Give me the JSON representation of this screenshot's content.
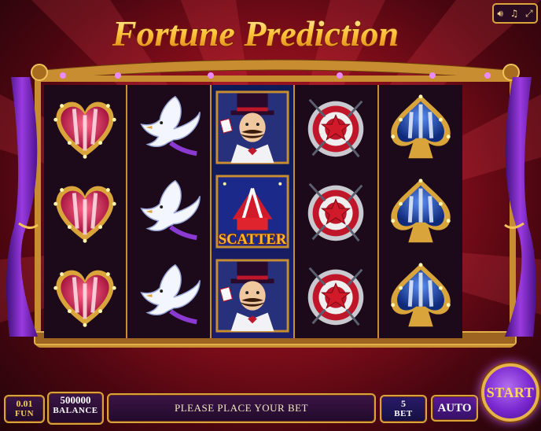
{
  "game": {
    "title": "Fortune Prediction"
  },
  "controls": {
    "sound_icon": "speaker-icon",
    "music_icon": "music-note-icon",
    "fullscreen_icon": "fullscreen-icon"
  },
  "reels": [
    [
      "heart",
      "heart",
      "heart"
    ],
    [
      "dove",
      "dove",
      "dove"
    ],
    [
      "magician",
      "scatter",
      "magician"
    ],
    [
      "target",
      "target",
      "target"
    ],
    [
      "spade",
      "spade",
      "spade"
    ]
  ],
  "scatter_label": "SCATTER",
  "bottom_bar": {
    "fun_value": "0.01",
    "fun_label": "FUN",
    "balance_value": "500000",
    "balance_label": "BALANCE",
    "message": "PLEASE PLACE YOUR BET",
    "bet_value": "5",
    "bet_label": "BET",
    "auto_label": "AUTO",
    "start_label": "START"
  },
  "colors": {
    "gold": "#d9a43a",
    "background_red": "#8e0f1c",
    "start_purple": "#7a28d0"
  }
}
